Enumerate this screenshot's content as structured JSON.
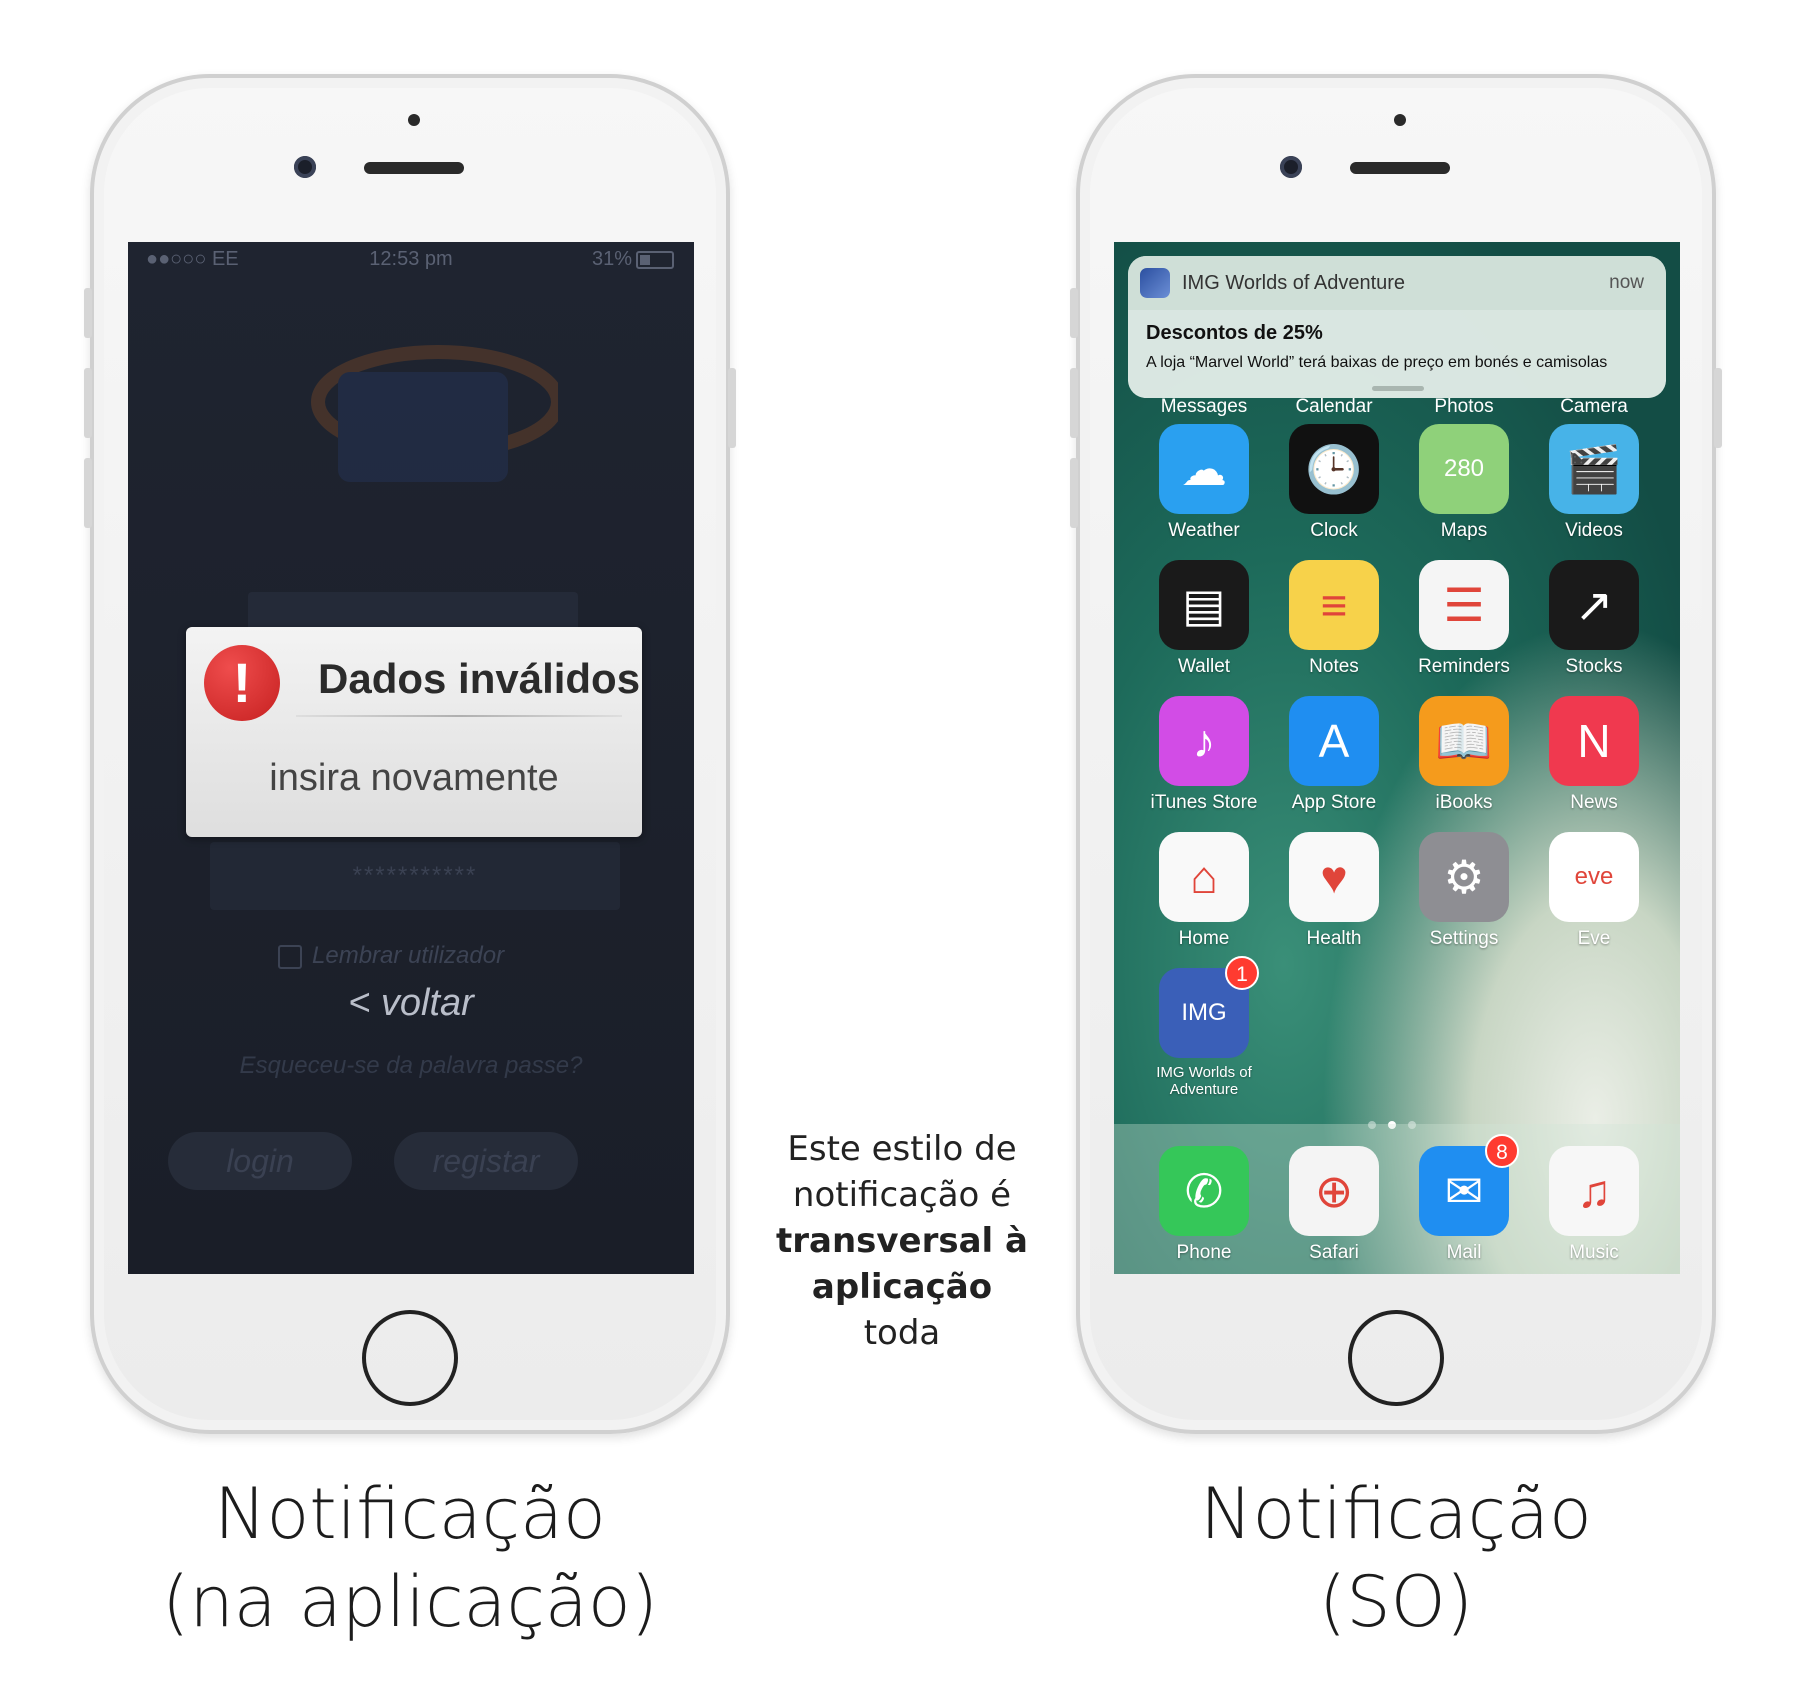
{
  "left_phone": {
    "status": {
      "carrier": "●●○○○ EE",
      "time": "12:53 pm",
      "battery": "31%"
    },
    "bg_labels": {
      "password_mask": "***********",
      "remember": "Lembrar utilizador",
      "back": "< voltar",
      "forgot": "Esqueceu-se da palavra passe?",
      "login": "login",
      "register": "registar"
    },
    "alert": {
      "icon": "!",
      "title": "Dados inválidos",
      "message": "insira novamente"
    }
  },
  "right_phone": {
    "notification": {
      "app": "IMG Worlds of Adventure",
      "time": "now",
      "title": "Descontos de 25%",
      "body": "A loja “Marvel World” terá baixas de preço em bonés e camisolas"
    },
    "partial_row": [
      "Messages",
      "Calendar",
      "Photos",
      "Camera"
    ],
    "apps": [
      {
        "label": "Weather",
        "color": "#2aa0f0",
        "glyph": "☁"
      },
      {
        "label": "Clock",
        "color": "#111111",
        "glyph": "🕒"
      },
      {
        "label": "Maps",
        "color": "#8fd17a",
        "glyph": "280"
      },
      {
        "label": "Videos",
        "color": "#47b3e8",
        "glyph": "🎬"
      },
      {
        "label": "Wallet",
        "color": "#1a1a1a",
        "glyph": "▤"
      },
      {
        "label": "Notes",
        "color": "#f7d24a",
        "glyph": "≡"
      },
      {
        "label": "Reminders",
        "color": "#f5f5f5",
        "glyph": "☰"
      },
      {
        "label": "Stocks",
        "color": "#1a1a1a",
        "glyph": "↗"
      },
      {
        "label": "iTunes Store",
        "color": "#d24ce6",
        "glyph": "♪"
      },
      {
        "label": "App Store",
        "color": "#1f8ef1",
        "glyph": "A"
      },
      {
        "label": "iBooks",
        "color": "#f59b1c",
        "glyph": "📖"
      },
      {
        "label": "News",
        "color": "#f0394f",
        "glyph": "N"
      },
      {
        "label": "Home",
        "color": "#f9f9f9",
        "glyph": "⌂"
      },
      {
        "label": "Health",
        "color": "#f9f9f9",
        "glyph": "♥"
      },
      {
        "label": "Settings",
        "color": "#8e8e93",
        "glyph": "⚙"
      },
      {
        "label": "Eve",
        "color": "#ffffff",
        "glyph": "eve"
      },
      {
        "label": "IMG Worlds of Adventure",
        "color": "#3a5fb8",
        "glyph": "IMG",
        "badge": "1"
      }
    ],
    "dock": [
      {
        "label": "Phone",
        "color": "#35c759",
        "glyph": "✆"
      },
      {
        "label": "Safari",
        "color": "#f4f4f4",
        "glyph": "⊕"
      },
      {
        "label": "Mail",
        "color": "#1f8ef1",
        "glyph": "✉",
        "badge": "8"
      },
      {
        "label": "Music",
        "color": "#f7f7f7",
        "glyph": "♫"
      }
    ]
  },
  "captions": {
    "left_line1": "Notificação",
    "left_line2": "(na aplicação)",
    "right_line1": "Notificação",
    "right_line2": "(SO)",
    "middle_pre": "Este estilo de notificação é",
    "middle_bold": "transversal à aplicação",
    "middle_post": "toda"
  }
}
